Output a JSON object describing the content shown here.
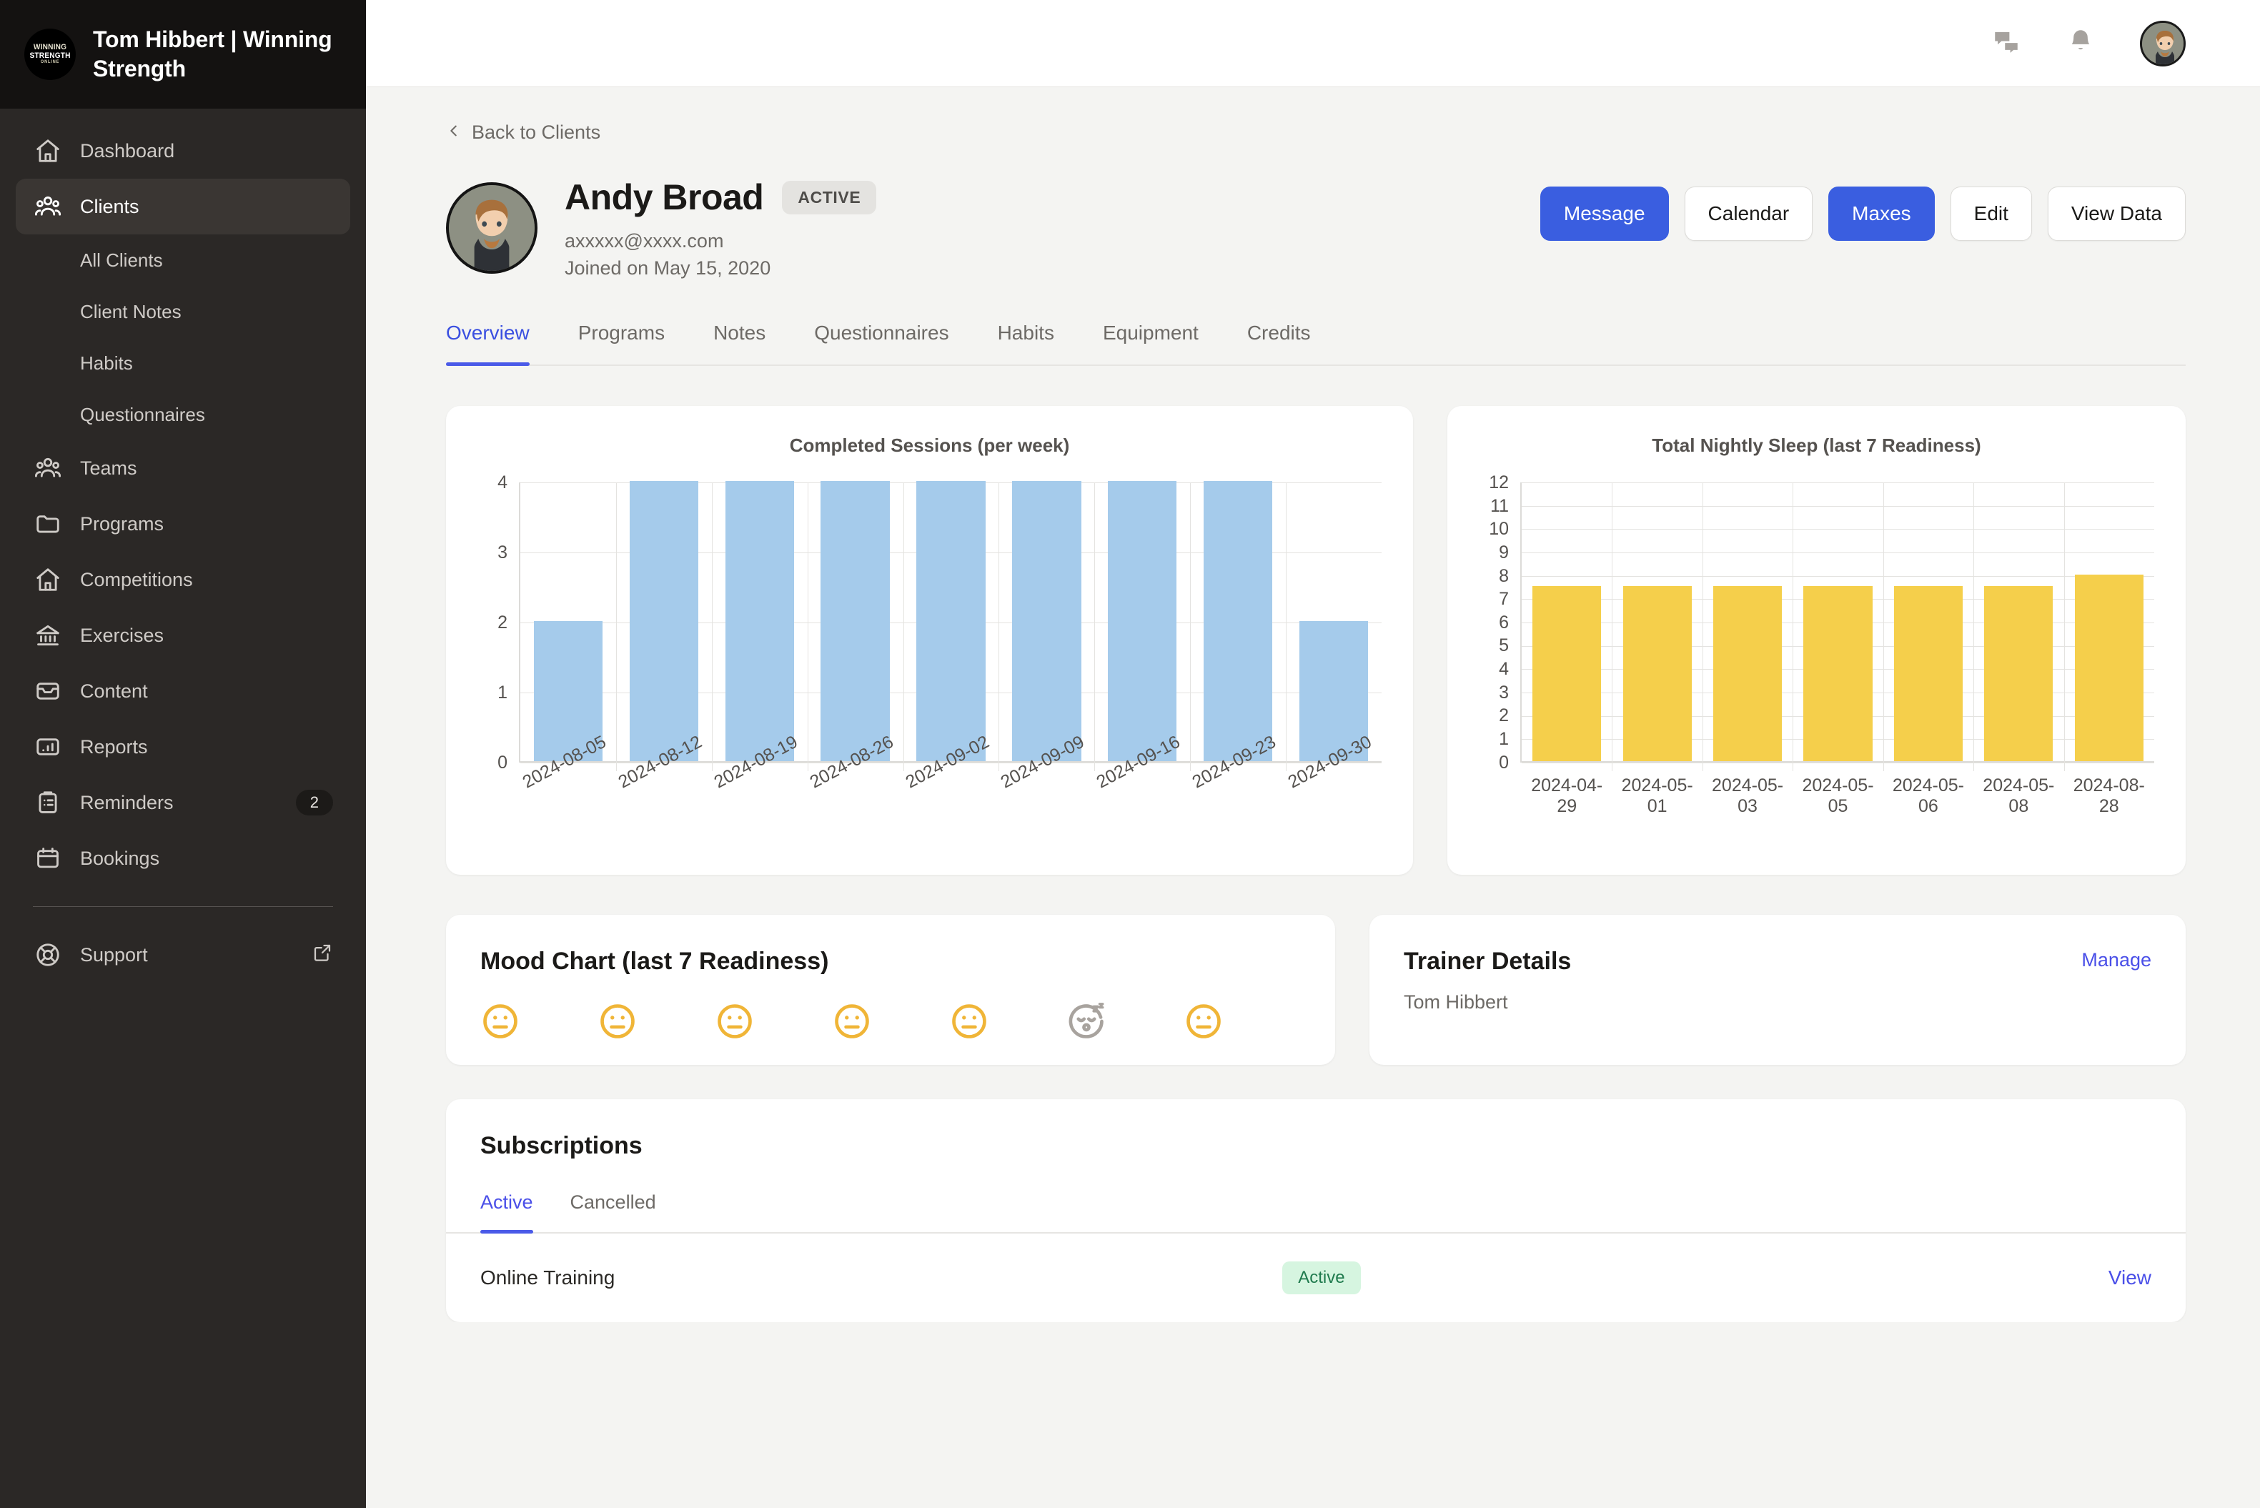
{
  "sidebar": {
    "brand": {
      "title": "Tom Hibbert | Winning Strength",
      "logo_l1": "WINNING",
      "logo_l2": "STRENGTH",
      "logo_l3": "ONLINE"
    },
    "items": [
      {
        "label": "Dashboard",
        "icon": "home-icon"
      },
      {
        "label": "Clients",
        "icon": "users-icon",
        "active": true
      },
      {
        "label": "All Clients",
        "sub": true
      },
      {
        "label": "Client Notes",
        "sub": true
      },
      {
        "label": "Habits",
        "sub": true
      },
      {
        "label": "Questionnaires",
        "sub": true
      },
      {
        "label": "Teams",
        "icon": "users-icon"
      },
      {
        "label": "Programs",
        "icon": "folder-icon"
      },
      {
        "label": "Competitions",
        "icon": "home-icon"
      },
      {
        "label": "Exercises",
        "icon": "bank-icon"
      },
      {
        "label": "Content",
        "icon": "inbox-icon"
      },
      {
        "label": "Reports",
        "icon": "bar-chart-icon"
      },
      {
        "label": "Reminders",
        "icon": "clipboard-icon",
        "badge": "2"
      },
      {
        "label": "Bookings",
        "icon": "calendar-icon"
      }
    ],
    "support": {
      "label": "Support",
      "icon": "lifebuoy-icon",
      "external_icon": "external-link-icon"
    }
  },
  "topbar": {
    "messages_icon": "chat-bubbles-icon",
    "notifications_icon": "bell-icon",
    "avatar": "user-avatar"
  },
  "breadcrumb": {
    "label": "Back to Clients",
    "icon": "chevron-left-icon"
  },
  "client": {
    "name": "Andy Broad",
    "status": "ACTIVE",
    "email": "axxxxx@xxxx.com",
    "joined": "Joined on May 15, 2020"
  },
  "actions": [
    {
      "label": "Message",
      "primary": true
    },
    {
      "label": "Calendar",
      "primary": false
    },
    {
      "label": "Maxes",
      "primary": true
    },
    {
      "label": "Edit",
      "primary": false
    },
    {
      "label": "View Data",
      "primary": false
    }
  ],
  "tabs": [
    {
      "label": "Overview",
      "active": true
    },
    {
      "label": "Programs"
    },
    {
      "label": "Notes"
    },
    {
      "label": "Questionnaires"
    },
    {
      "label": "Habits"
    },
    {
      "label": "Equipment"
    },
    {
      "label": "Credits"
    }
  ],
  "mood": {
    "title": "Mood Chart (last 7 Readiness)",
    "faces": [
      "neutral",
      "neutral",
      "neutral",
      "neutral",
      "neutral",
      "sleeping",
      "neutral"
    ],
    "color": "#f0b537",
    "sleep_color": "#a8a39e"
  },
  "trainer": {
    "title": "Trainer Details",
    "name": "Tom Hibbert",
    "manage_label": "Manage"
  },
  "subscriptions": {
    "title": "Subscriptions",
    "tabs": [
      {
        "label": "Active",
        "active": true
      },
      {
        "label": "Cancelled"
      }
    ],
    "rows": [
      {
        "name": "Online Training",
        "status": "Active",
        "action": "View"
      }
    ]
  },
  "colors": {
    "accent": "#3a5ee0",
    "link": "#4a4fe8",
    "sessions_bar": "#a5cbeb",
    "sleep_bar": "#f5cf4b",
    "badge_green_bg": "#d6f5e0",
    "badge_green_fg": "#1f7a4d"
  },
  "chart_data": [
    {
      "type": "bar",
      "title": "Completed Sessions (per week)",
      "categories": [
        "2024-08-05",
        "2024-08-12",
        "2024-08-19",
        "2024-08-26",
        "2024-09-02",
        "2024-09-09",
        "2024-09-16",
        "2024-09-23",
        "2024-09-30"
      ],
      "values": [
        2,
        4,
        4,
        4,
        4,
        4,
        4,
        4,
        2
      ],
      "yticks": [
        0,
        1,
        2,
        3,
        4
      ],
      "ylim": [
        0,
        4
      ],
      "xlabel": "",
      "ylabel": "",
      "grid": true,
      "legend": "none",
      "color": "#a5cbeb"
    },
    {
      "type": "bar",
      "title": "Total Nightly Sleep (last 7 Readiness)",
      "categories": [
        "2024-04-29",
        "2024-05-01",
        "2024-05-03",
        "2024-05-05",
        "2024-05-06",
        "2024-05-08",
        "2024-08-28"
      ],
      "values": [
        7.5,
        7.5,
        7.5,
        7.5,
        7.5,
        7.5,
        8
      ],
      "yticks": [
        0,
        1,
        2,
        3,
        4,
        5,
        6,
        7,
        8,
        9,
        10,
        11,
        12
      ],
      "ylim": [
        0,
        12
      ],
      "xlabel": "",
      "ylabel": "",
      "grid": true,
      "legend": "none",
      "color": "#f5cf4b"
    }
  ]
}
